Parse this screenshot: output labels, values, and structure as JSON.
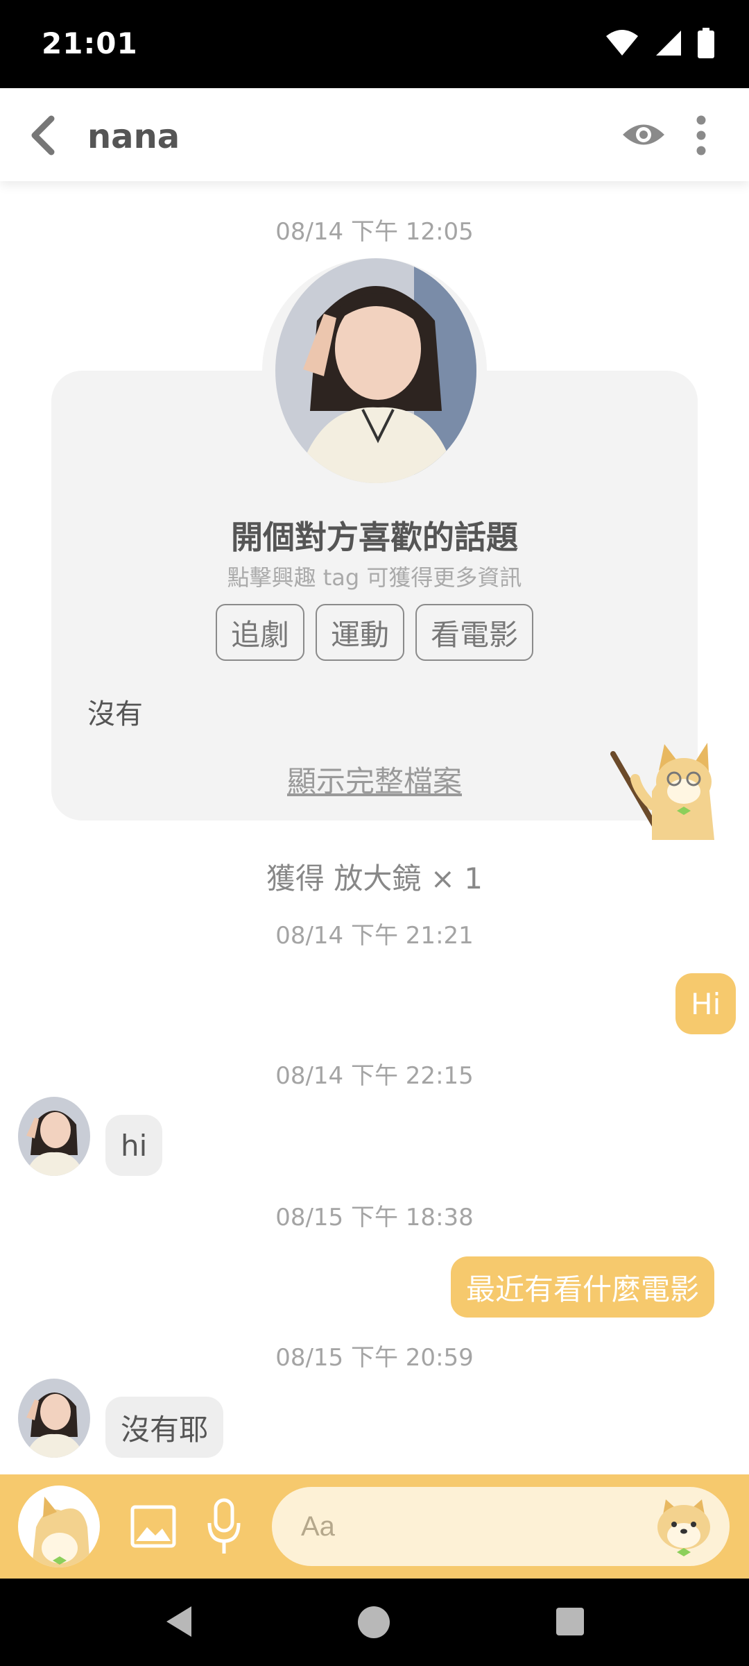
{
  "status_bar": {
    "time": "21:01"
  },
  "header": {
    "title": "nana"
  },
  "card": {
    "timestamp": "08/14 下午 12:05",
    "title": "開個對方喜歡的話題",
    "subtitle": "點擊興趣 tag 可獲得更多資訊",
    "tags": [
      "追劇",
      "運動",
      "看電影"
    ],
    "answer": "沒有",
    "show_profile_link": "顯示完整檔案"
  },
  "reward": "獲得 放大鏡 × 1",
  "messages": [
    {
      "timestamp": "08/14 下午 21:21",
      "direction": "out",
      "text": "Hi"
    },
    {
      "timestamp": "08/14 下午 22:15",
      "direction": "in",
      "text": "hi"
    },
    {
      "timestamp": "08/15 下午 18:38",
      "direction": "out",
      "text": "最近有看什麼電影"
    },
    {
      "timestamp": "08/15 下午 20:59",
      "direction": "in",
      "text": "沒有耶"
    }
  ],
  "input": {
    "placeholder": "Aa"
  },
  "colors": {
    "accent": "#f6c96d",
    "input_bg": "#fdf1d6",
    "card_bg": "#f3f3f3"
  }
}
